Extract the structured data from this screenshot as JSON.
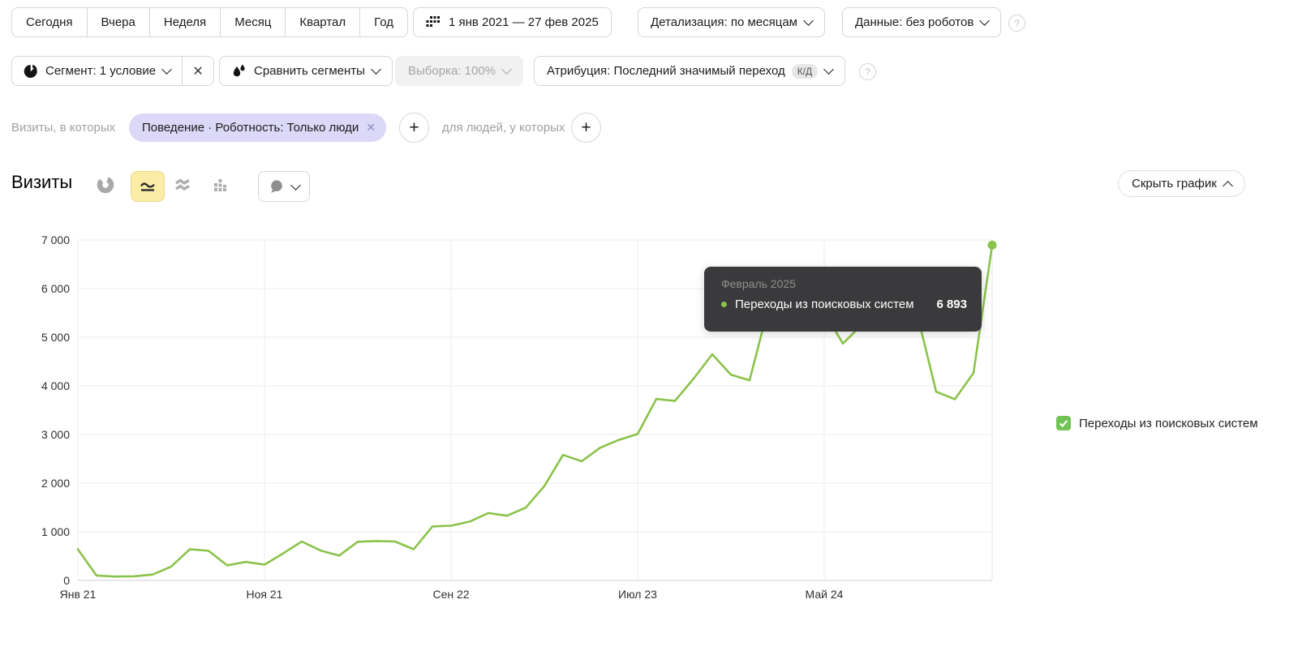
{
  "icons": {
    "help": "?",
    "close": "✕",
    "plus": "+"
  },
  "toolbar": {
    "period_buttons": [
      "Сегодня",
      "Вчера",
      "Неделя",
      "Месяц",
      "Квартал",
      "Год"
    ],
    "date_range": "1 янв 2021 — 27 фев 2025",
    "detail": "Детализация: по месяцам",
    "data_mode": "Данные: без роботов"
  },
  "segment_bar": {
    "segment": "Сегмент: 1 условие",
    "compare": "Сравнить сегменты",
    "sampling": "Выборка: 100%",
    "attribution": "Атрибуция: Последний значимый переход",
    "attribution_badge": "К/Д"
  },
  "filter_bar": {
    "visits_label": "Визиты, в которых",
    "chip": "Поведение · Роботность: Только люди",
    "people_label": "для людей, у которых"
  },
  "chart_header": {
    "title": "Визиты",
    "hide_button": "Скрыть график"
  },
  "tooltip": {
    "title": "Февраль 2025",
    "series": "Переходы из поисковых систем",
    "value": "6 893"
  },
  "legend": {
    "label": "Переходы из поисковых систем"
  },
  "colors": {
    "accent_green": "#8ac34a",
    "selected_yellow_bg": "#fceda6",
    "selected_yellow_border": "#ecd88c",
    "chip_bg": "#dcd8f7",
    "tooltip_bg": "#3a3a3c",
    "grid_line": "#ededed",
    "axis_line": "#cfcfcf"
  },
  "chart_data": {
    "type": "line",
    "title": "Визиты",
    "x": [
      "Янв 21",
      "Фев 21",
      "Мар 21",
      "Апр 21",
      "Май 21",
      "Июн 21",
      "Июл 21",
      "Авг 21",
      "Сен 21",
      "Окт 21",
      "Ноя 21",
      "Дек 21",
      "Янв 22",
      "Фев 22",
      "Мар 22",
      "Апр 22",
      "Май 22",
      "Июн 22",
      "Июл 22",
      "Авг 22",
      "Сен 22",
      "Окт 22",
      "Ноя 22",
      "Дек 22",
      "Янв 23",
      "Фев 23",
      "Мар 23",
      "Апр 23",
      "Май 23",
      "Июн 23",
      "Июл 23",
      "Авг 23",
      "Сен 23",
      "Окт 23",
      "Ноя 23",
      "Дек 23",
      "Янв 24",
      "Фев 24",
      "Мар 24",
      "Апр 24",
      "Май 24",
      "Июн 24",
      "Июл 24",
      "Авг 24",
      "Сен 24",
      "Окт 24",
      "Ноя 24",
      "Дек 24",
      "Янв 25",
      "Фев 25"
    ],
    "series": [
      {
        "name": "Переходы из поисковых систем",
        "color": "#8ac34a",
        "values": [
          640,
          100,
          80,
          85,
          120,
          285,
          640,
          610,
          310,
          380,
          325,
          555,
          800,
          615,
          510,
          795,
          810,
          800,
          640,
          1110,
          1125,
          1210,
          1385,
          1330,
          1495,
          1940,
          2580,
          2450,
          2730,
          2890,
          3010,
          3730,
          3690,
          4150,
          4650,
          4230,
          4115,
          5600,
          5900,
          5750,
          5520,
          4870,
          5250,
          5650,
          5890,
          5450,
          3880,
          3725,
          4265,
          6893
        ]
      }
    ],
    "ylim": [
      0,
      7000
    ],
    "y_ticks": [
      0,
      1000,
      2000,
      3000,
      4000,
      5000,
      6000,
      7000
    ],
    "y_tick_labels": [
      "0",
      "1 000",
      "2 000",
      "3 000",
      "4 000",
      "5 000",
      "6 000",
      "7 000"
    ],
    "x_tick_positions": [
      0,
      10,
      20,
      30,
      40
    ],
    "x_tick_labels": [
      "Янв 21",
      "Ноя 21",
      "Сен 22",
      "Июл 23",
      "Май 24"
    ],
    "grid": true,
    "legend_position": "right",
    "highlighted_point": {
      "x": "Фев 25",
      "month_label": "Февраль 2025",
      "value": 6893,
      "value_label": "6 893"
    }
  }
}
